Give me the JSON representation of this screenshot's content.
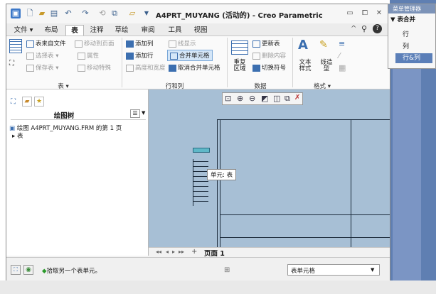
{
  "window": {
    "title": "A4PRT_MUYANG (活动的) - Creo Parametric"
  },
  "menu_tabs": [
    "文件",
    "布局",
    "表",
    "注释",
    "草绘",
    "审阅",
    "工具",
    "视图"
  ],
  "active_tab": "表",
  "ribbon": {
    "table_group": {
      "table_from_file": "表来自文件",
      "move_to_page": "移动到页面",
      "select_table": "选择表",
      "properties": "属性",
      "save_table": "保存表",
      "move_special": "移动特殊",
      "label": "表"
    },
    "rows_cols_group": {
      "add_column": "添加列",
      "add_row": "添加行",
      "height_width": "高度和宽度",
      "line_display": "线显示",
      "merge_cells": "合并单元格",
      "unmerge_cells": "取消合并单元格",
      "label": "行和列"
    },
    "data_group": {
      "repeat_region": "重复区域",
      "update_table": "更新表",
      "remove_content": "删除内容",
      "toggle_symbol": "切换符号",
      "label": "数据"
    },
    "format_group": {
      "text_style": "文本样式",
      "line_style": "线造型",
      "label": "格式"
    }
  },
  "left_panel": {
    "tree_title": "绘图树",
    "tree_root": "绘图 A4PRT_MUYANG.FRM 的第 1 页",
    "tree_child": "表"
  },
  "canvas": {
    "tooltip": "单元: 表"
  },
  "page_bar": {
    "page_label": "页面 1"
  },
  "status_bar": {
    "message": "拾取另一个表单元。",
    "filter_value": "表单元格"
  },
  "right_panel": {
    "title": "菜单管理器",
    "menu_header": "▼ 表合并",
    "items": [
      "行",
      "列",
      "行&列"
    ]
  }
}
